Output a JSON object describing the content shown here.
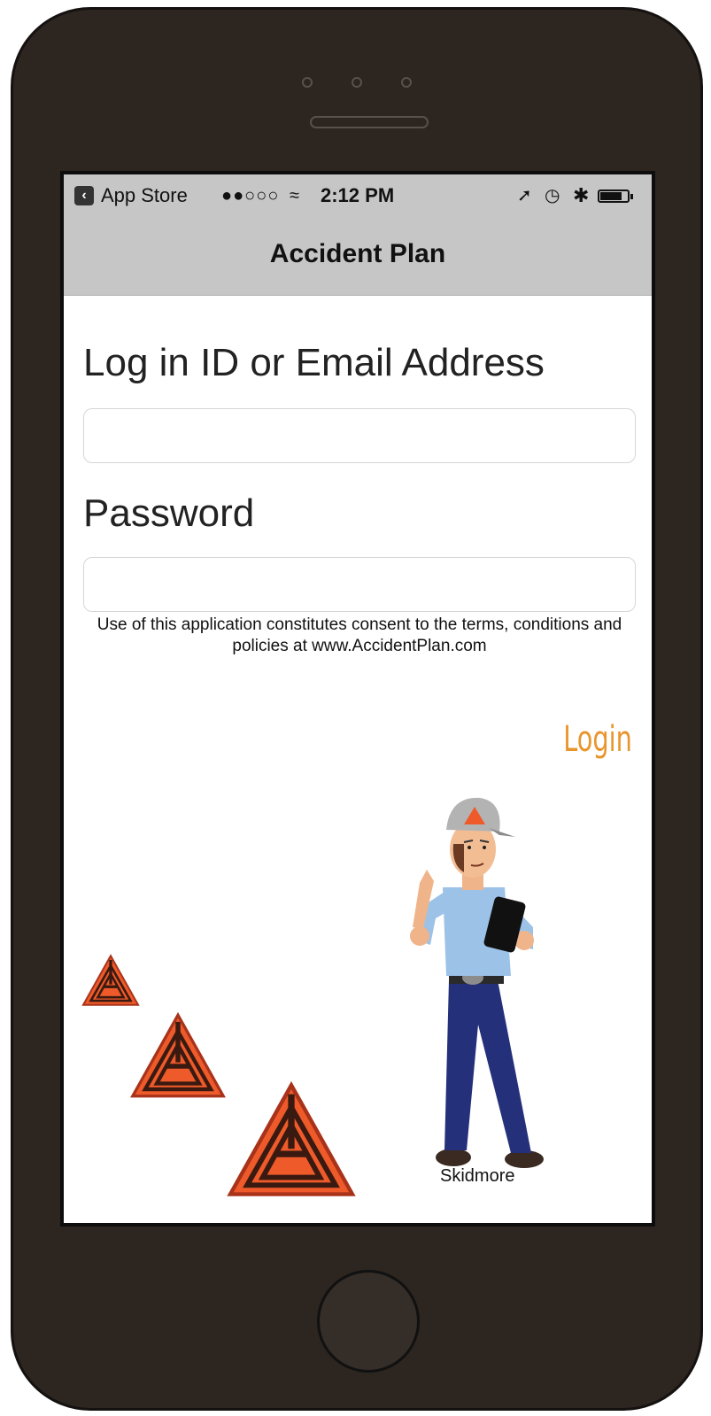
{
  "status_bar": {
    "carrier": "App Store",
    "signal": "●●○○○",
    "time": "2:12 PM",
    "icons": [
      "back-icon",
      "wifi-icon",
      "location-icon",
      "alarm-icon",
      "bluetooth-icon",
      "battery-icon"
    ]
  },
  "nav": {
    "title": "Accident Plan"
  },
  "form": {
    "login_label": "Log in ID or Email Address",
    "login_value": "",
    "password_label": "Password",
    "password_value": "",
    "terms": "Use of this application constitutes consent to the terms, conditions and policies at www.AccidentPlan.com",
    "login_button": "Login"
  },
  "mascot": {
    "name": "Skidmore"
  },
  "colors": {
    "accent": "#e8962c",
    "nav_background": "#c6c6c6",
    "logo_orange": "#ef5a2a",
    "device_body": "#2c2520"
  }
}
